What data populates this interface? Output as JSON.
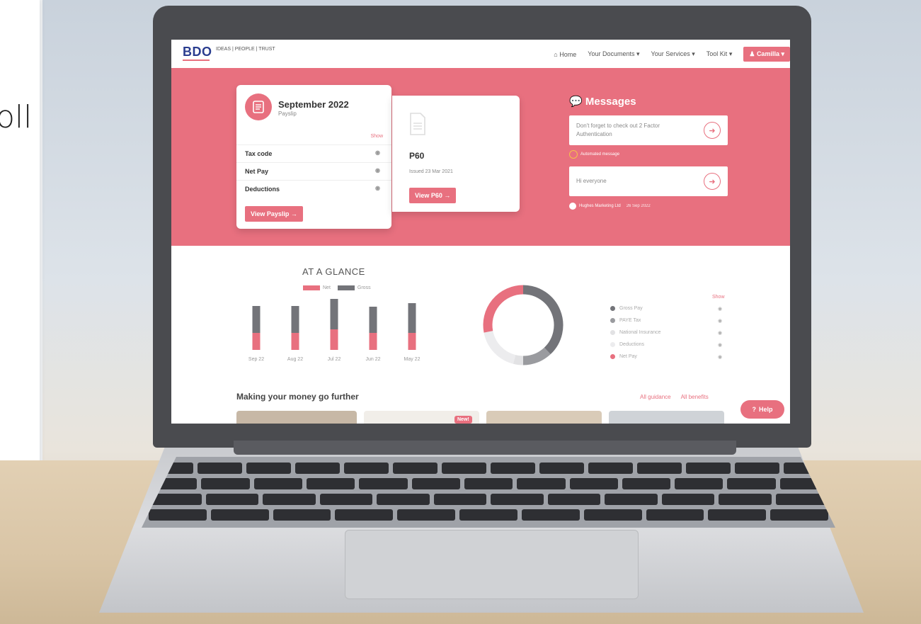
{
  "background": {
    "left_text": "oll"
  },
  "nav": {
    "logo": "BDO",
    "tagline": "IDEAS | PEOPLE | TRUST",
    "home": "Home",
    "documents": "Your Documents",
    "services": "Your Services",
    "toolkit": "Tool Kit",
    "user": "Camilla"
  },
  "payslip": {
    "title": "September 2022",
    "subtitle": "Payslip",
    "show_label": "Show",
    "rows": [
      "Tax code",
      "Net Pay",
      "Deductions"
    ],
    "button": "View Payslip"
  },
  "p60": {
    "title": "P60",
    "issued": "Issued 23 Mar 2021",
    "button": "View P60"
  },
  "messages": {
    "title": "Messages",
    "items": [
      {
        "text": "Don't forget to check out 2 Factor Authentication",
        "meta": "Automated message"
      },
      {
        "text": "Hi everyone",
        "meta": "Hughes Marketing Ltd",
        "date": "26 Sep 2022"
      }
    ]
  },
  "glance": {
    "title": "AT A GLANCE",
    "show_label": "Show",
    "breakdown": [
      "Gross Pay",
      "PAYE Tax",
      "National Insurance",
      "Deductions",
      "Net Pay"
    ]
  },
  "chart_data": [
    {
      "type": "bar",
      "categories": [
        "Sep 22",
        "Aug 22",
        "Jul 22",
        "Jun 22",
        "May 22"
      ],
      "series": [
        {
          "name": "Net",
          "values": [
            24,
            24,
            29,
            24,
            24
          ]
        },
        {
          "name": "Gross",
          "values": [
            62,
            62,
            72,
            61,
            66
          ]
        }
      ],
      "colors": {
        "Net": "#e8707f",
        "Gross": "#737479"
      },
      "legend": "top"
    },
    {
      "type": "pie",
      "labels": [
        "Gross Pay",
        "PAYE Tax",
        "National Insurance",
        "Deductions",
        "Net Pay"
      ],
      "values": [
        38,
        12,
        4,
        18,
        28
      ],
      "colors": [
        "#737479",
        "#9a9b9f",
        "#e2e2e4",
        "#ececee",
        "#e8707f"
      ]
    }
  ],
  "money": {
    "title": "Making your money go further",
    "guidance": "All guidance",
    "benefits": "All benefits",
    "new_badge": "New!"
  },
  "help": {
    "label": "Help"
  },
  "colors": {
    "accent": "#e8707f",
    "brand_blue": "#2a3d8f",
    "grey": "#737479"
  }
}
